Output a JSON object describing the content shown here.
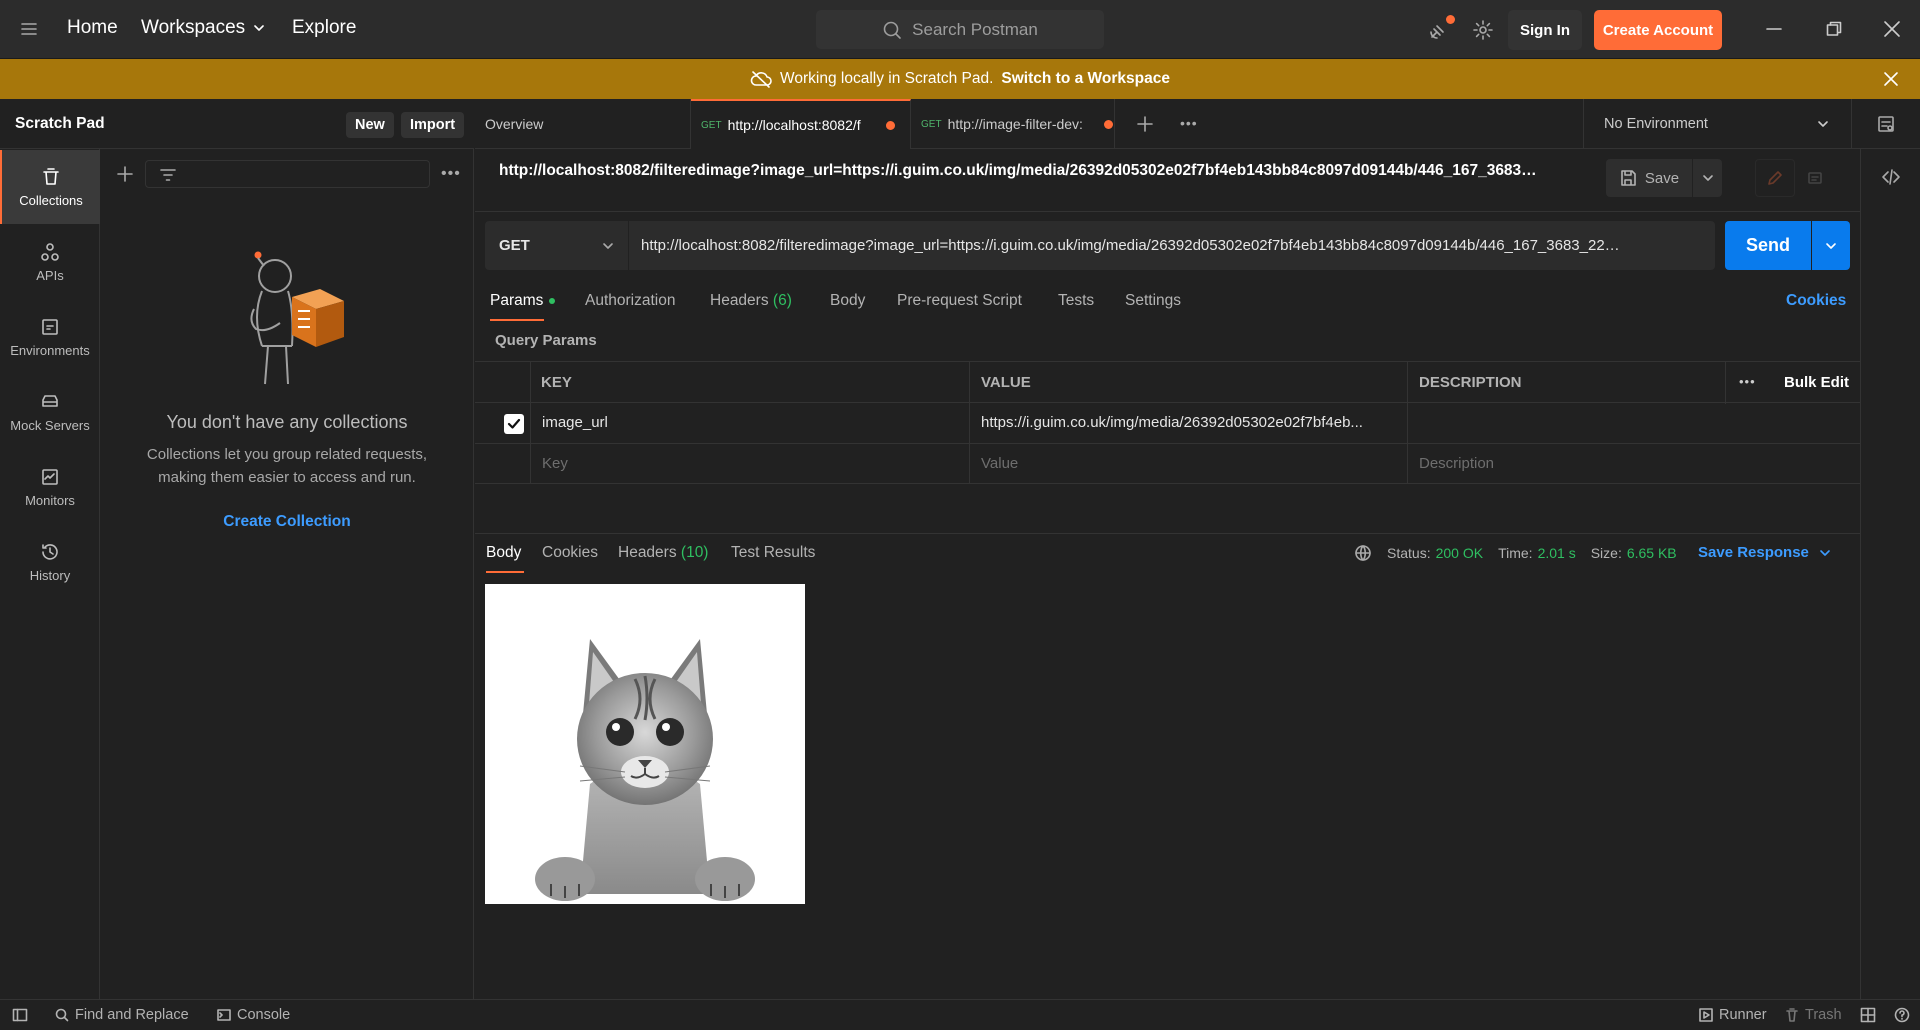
{
  "topbar": {
    "home": "Home",
    "workspaces": "Workspaces",
    "explore": "Explore",
    "search_placeholder": "Search Postman",
    "sign_in": "Sign In",
    "create_account": "Create Account"
  },
  "banner": {
    "text": "Working locally in Scratch Pad.",
    "link": "Switch to a Workspace"
  },
  "sidebar": {
    "title": "Scratch Pad",
    "new_label": "New",
    "import_label": "Import",
    "rail": [
      {
        "label": "Collections"
      },
      {
        "label": "APIs"
      },
      {
        "label": "Environments"
      },
      {
        "label": "Mock Servers"
      },
      {
        "label": "Monitors"
      },
      {
        "label": "History"
      }
    ],
    "empty_title": "You don't have any collections",
    "empty_desc_1": "Collections let you group related requests,",
    "empty_desc_2": "making them easier to access and run.",
    "create_collection": "Create Collection"
  },
  "tabs": {
    "overview": "Overview",
    "tab1_method": "GET",
    "tab1_label": "http://localhost:8082/f",
    "tab2_method": "GET",
    "tab2_label": "http://image-filter-dev:",
    "environment": "No Environment"
  },
  "request": {
    "title_url": "http://localhost:8082/filteredimage?image_url=https://i.guim.co.uk/img/media/26392d05302e02f7bf4eb143bb84c8097d09144b/446_167_3683…",
    "save_label": "Save",
    "method": "GET",
    "url": "http://localhost:8082/filteredimage?image_url=https://i.guim.co.uk/img/media/26392d05302e02f7bf4eb143bb84c8097d09144b/446_167_3683_22…",
    "send_label": "Send",
    "subtabs": {
      "params": "Params",
      "authorization": "Authorization",
      "headers": "Headers",
      "headers_count": "(6)",
      "body": "Body",
      "prerequest": "Pre-request Script",
      "tests": "Tests",
      "settings": "Settings",
      "cookies": "Cookies"
    },
    "query_params_label": "Query Params",
    "table": {
      "col_key": "KEY",
      "col_value": "VALUE",
      "col_description": "DESCRIPTION",
      "bulk_edit": "Bulk Edit",
      "row_key": "image_url",
      "row_value": "https://i.guim.co.uk/img/media/26392d05302e02f7bf4eb...",
      "placeholder_key": "Key",
      "placeholder_value": "Value",
      "placeholder_description": "Description"
    }
  },
  "response": {
    "tabs": {
      "body": "Body",
      "cookies": "Cookies",
      "headers": "Headers",
      "headers_count": "(10)",
      "test_results": "Test Results"
    },
    "status_label": "Status:",
    "status_value": "200 OK",
    "time_label": "Time:",
    "time_value": "2.01 s",
    "size_label": "Size:",
    "size_value": "6.65 KB",
    "save_response": "Save Response"
  },
  "statusbar": {
    "find_replace": "Find and Replace",
    "console": "Console",
    "runner": "Runner",
    "trash": "Trash"
  },
  "colors": {
    "accent": "#ff6c37",
    "banner": "#a7770b",
    "send": "#097bed",
    "success": "#2fbf61"
  }
}
